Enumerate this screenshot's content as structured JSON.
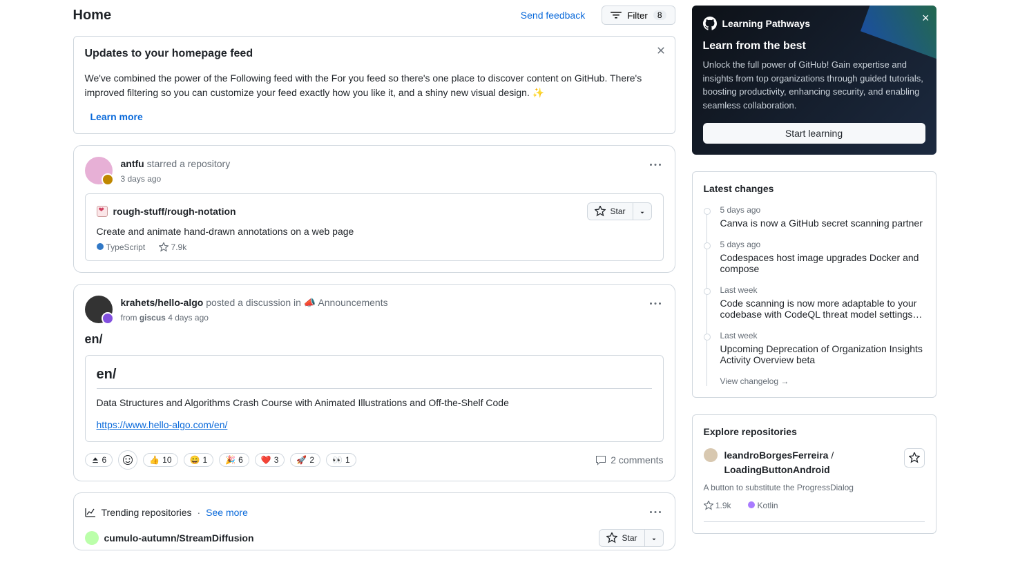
{
  "header": {
    "title": "Home",
    "feedback": "Send feedback",
    "filter_label": "Filter",
    "filter_count": "8"
  },
  "notice": {
    "title": "Updates to your homepage feed",
    "body": "We've combined the power of the Following feed with the For you feed so there's one place to discover content on GitHub. There's improved filtering so you can customize your feed exactly how you like it, and a shiny new visual design. ✨",
    "learn_more": "Learn more"
  },
  "feed": {
    "item1": {
      "user": "antfu",
      "action": "starred a repository",
      "time": "3 days ago",
      "repo_name": "rough-stuff/rough-notation",
      "repo_desc": "Create and animate hand-drawn annotations on a web page",
      "language": "TypeScript",
      "language_color": "#3178c6",
      "stars": "7.9k",
      "star_btn": "Star"
    },
    "item2": {
      "user": "krahets/hello-algo",
      "action": "posted a discussion in",
      "category": "Announcements",
      "from_label": "from",
      "from_repo": "giscus",
      "time": "4 days ago",
      "title": "en/",
      "body_title": "en/",
      "body_text": "Data Structures and Algorithms Crash Course with Animated Illustrations and Off-the-Shelf Code",
      "body_link": "https://www.hello-algo.com/en/",
      "reactions": {
        "upvote": "6",
        "thumbs": "10",
        "smile": "1",
        "tada": "6",
        "heart": "3",
        "rocket": "2",
        "eyes": "1"
      },
      "comments": "2 comments"
    },
    "trending": {
      "label": "Trending repositories",
      "see_more": "See more",
      "repo1_name": "cumulo-autumn/StreamDiffusion",
      "star_btn": "Star"
    }
  },
  "promo": {
    "logo_text": "Learning Pathways",
    "title": "Learn from the best",
    "body": "Unlock the full power of GitHub! Gain expertise and insights from top organizations through guided tutorials, boosting productivity, enhancing security, and enabling seamless collaboration.",
    "cta": "Start learning"
  },
  "changelog": {
    "title": "Latest changes",
    "items": [
      {
        "time": "5 days ago",
        "title": "Canva is now a GitHub secret scanning partner"
      },
      {
        "time": "5 days ago",
        "title": "Codespaces host image upgrades Docker and compose"
      },
      {
        "time": "Last week",
        "title": "Code scanning is now more adaptable to your codebase with CodeQL threat model settings…"
      },
      {
        "time": "Last week",
        "title": "Upcoming Deprecation of Organization Insights Activity Overview beta"
      }
    ],
    "view_all": "View changelog →"
  },
  "explore": {
    "title": "Explore repositories",
    "repo1": {
      "user": "leandroBorgesFerreira",
      "slash": "/",
      "name": "LoadingButtonAndroid",
      "desc": "A button to substitute the ProgressDialog",
      "stars": "1.9k",
      "language": "Kotlin",
      "language_color": "#A97BFF"
    }
  }
}
